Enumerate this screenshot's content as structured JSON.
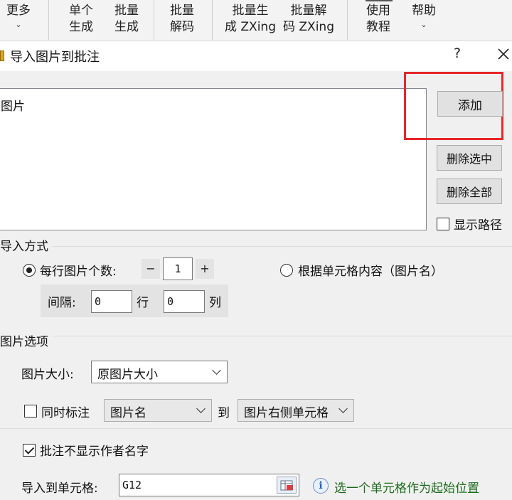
{
  "ribbon": {
    "more": {
      "label": "更多"
    },
    "single_generate": {
      "line1": "单个",
      "line2": "生成"
    },
    "batch_generate": {
      "line1": "批量",
      "line2": "生成"
    },
    "batch_decode": {
      "line1": "批量",
      "line2": "解码"
    },
    "batch_gen_zxing": {
      "line1": "批量生",
      "line2": "成 ZXing"
    },
    "batch_dec_zxing": {
      "line1": "批量解",
      "line2": "码 ZXing"
    },
    "tutorial": {
      "line1": "使用",
      "line2": "教程"
    },
    "help": {
      "label": "帮助"
    }
  },
  "dialog": {
    "title": "导入图片到批注",
    "help_glyph": "?",
    "image_list": {
      "header": "图片"
    },
    "buttons": {
      "add": "添加",
      "delete_selected": "删除选中",
      "delete_all": "删除全部"
    },
    "show_path": {
      "label": "显示路径",
      "checked": false
    },
    "import_mode": {
      "section_title": "导入方式",
      "per_row": {
        "label": "每行图片个数:",
        "selected": true,
        "minus": "−",
        "plus": "+",
        "value": "1"
      },
      "by_cell": {
        "label": "根据单元格内容（图片名）",
        "selected": false
      },
      "spacing": {
        "label": "间隔:",
        "rows_value": "0",
        "rows_unit": "行",
        "cols_value": "0",
        "cols_unit": "列"
      }
    },
    "image_options": {
      "section_title": "图片选项",
      "size": {
        "label": "图片大小:",
        "selected": "原图片大小"
      },
      "annotate": {
        "label": "同时标注",
        "checked": false,
        "source": "图片名",
        "to_label": "到",
        "target": "图片右侧单元格"
      },
      "hide_author": {
        "label": "批注不显示作者名字",
        "checked": true
      },
      "import_to_cell": {
        "label": "导入到单元格:",
        "value": "G12",
        "hint": "选一个单元格作为起始位置"
      }
    }
  },
  "colors": {
    "highlight": "#e8262a",
    "hint_text": "#1e6b1e"
  }
}
